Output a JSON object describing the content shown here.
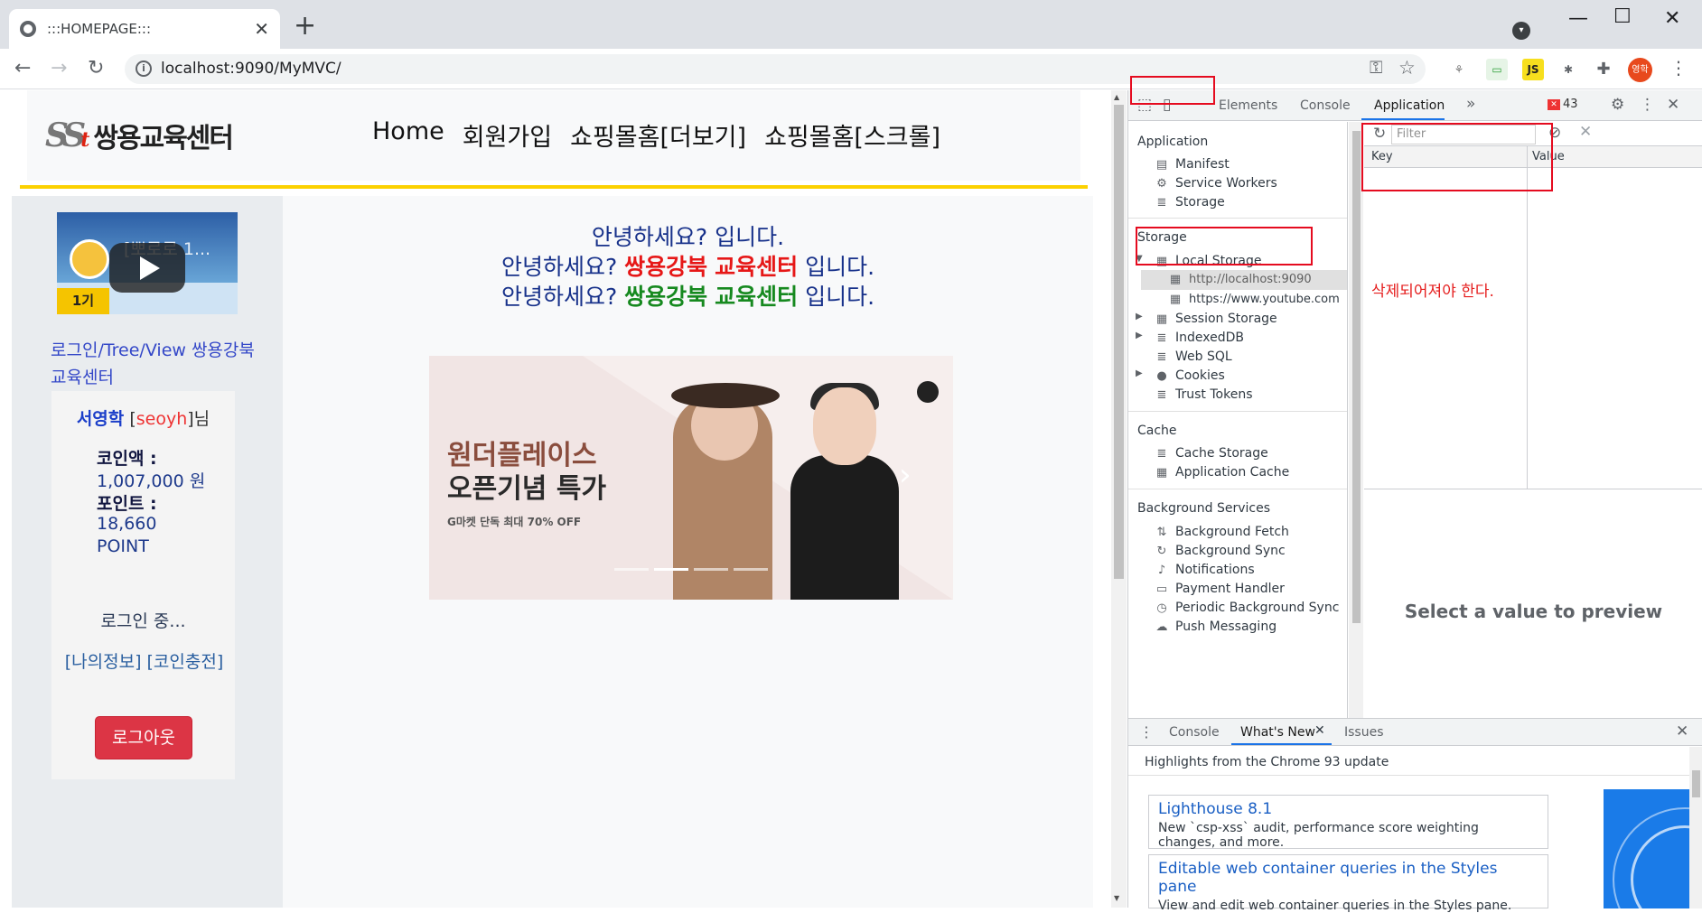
{
  "browser": {
    "tab_title": ":::HOMEPAGE:::",
    "tab_close": "✕",
    "new_tab": "+",
    "url": "localhost:9090/MyMVC/",
    "avatar_text": "영학"
  },
  "site": {
    "logo_mark": "SS",
    "logo_mark_t": "t",
    "logo_name": "쌍용교육센터",
    "nav": [
      "Home",
      "회원가입",
      "쇼핑몰홈[더보기]",
      "쇼핑몰홈[스크롤]"
    ]
  },
  "sidebar": {
    "video_title": "[뽀로로 1...",
    "video_episode": "1기",
    "link": "로그인/Tree/View  쌍용강북 교육센터",
    "user_name": "서영학",
    "user_id_open": "[",
    "user_id": "seoyh",
    "user_id_close": "]님",
    "coin_label": "코인액 :",
    "coin_value": "1,007,000 원",
    "point_label": "포인트 :",
    "point_value": "18,660",
    "point_unit": "POINT",
    "login_status": "로그인 중...",
    "links": "[나의정보]  [코인충전]",
    "logout": "로그아웃"
  },
  "main": {
    "greet1": "안녕하세요? 입니다.",
    "greet_prefix": "안녕하세요?",
    "greet_org_a": "쌍용강북",
    "greet_org_b": "교육센터",
    "greet_suffix": "입니다.",
    "banner_line1": "원더플레이스",
    "banner_line2": "오픈기념 특가",
    "banner_sub": "G마켓 단독 최대 70% OFF",
    "banner_arrow": "›"
  },
  "devtools": {
    "tabs": [
      "Elements",
      "Console",
      "Application"
    ],
    "more": "»",
    "error_count": "43",
    "app_section": "Application",
    "app_items": [
      "Manifest",
      "Service Workers",
      "Storage"
    ],
    "storage_section": "Storage",
    "local_storage": "Local Storage",
    "local_storage_children": [
      "http://localhost:9090",
      "https://www.youtube.com"
    ],
    "storage_items": [
      "Session Storage",
      "IndexedDB",
      "Web SQL",
      "Cookies",
      "Trust Tokens"
    ],
    "cache_section": "Cache",
    "cache_items": [
      "Cache Storage",
      "Application Cache"
    ],
    "bg_section": "Background Services",
    "bg_items": [
      "Background Fetch",
      "Background Sync",
      "Notifications",
      "Payment Handler",
      "Periodic Background Sync",
      "Push Messaging"
    ],
    "filter_placeholder": "Filter",
    "col_key": "Key",
    "col_value": "Value",
    "annotation": "삭제되어져야 한다.",
    "preview": "Select a value to preview",
    "drawer_tabs": [
      "Console",
      "What's New",
      "Issues"
    ],
    "whatsnew_head": "Highlights from the Chrome 93 update",
    "cards": [
      {
        "title": "Lighthouse 8.1",
        "desc": "New `csp-xss` audit, performance score weighting changes, and more."
      },
      {
        "title": "Editable web container queries in the Styles pane",
        "desc": "View and edit web container queries in the Styles pane."
      }
    ]
  },
  "colors": {
    "highlight": "#e50b1f",
    "logout_button": "#dc3545",
    "accent_blue": "#1a73e8",
    "yellow_line": "#fcd100"
  }
}
